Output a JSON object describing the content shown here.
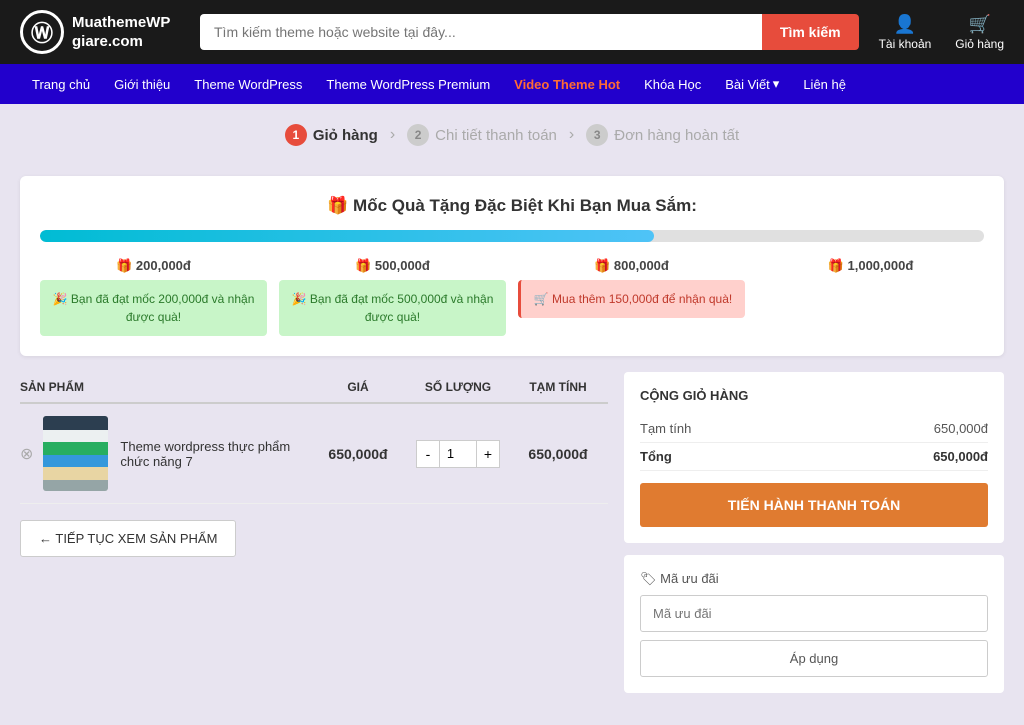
{
  "header": {
    "logo_icon": "Ⓦ",
    "logo_name": "MuathemeWP",
    "logo_subtitle": "giare.com",
    "search_placeholder": "Tìm kiếm theme hoặc website tại đây...",
    "search_btn_label": "Tìm kiếm",
    "account_label": "Tài khoản",
    "cart_label": "Giỏ hàng"
  },
  "nav": {
    "items": [
      {
        "label": "Trang chủ",
        "hot": false,
        "dropdown": false
      },
      {
        "label": "Giới thiệu",
        "hot": false,
        "dropdown": false
      },
      {
        "label": "Theme WordPress",
        "hot": false,
        "dropdown": false
      },
      {
        "label": "Theme WordPress Premium",
        "hot": false,
        "dropdown": false
      },
      {
        "label": "Video Theme Hot",
        "hot": true,
        "dropdown": false
      },
      {
        "label": "Khóa Học",
        "hot": false,
        "dropdown": false
      },
      {
        "label": "Bài Viết",
        "hot": false,
        "dropdown": true
      },
      {
        "label": "Liên hệ",
        "hot": false,
        "dropdown": false
      }
    ]
  },
  "steps": [
    {
      "number": "1",
      "label": "Giỏ hàng",
      "active": true
    },
    {
      "number": "2",
      "label": "Chi tiết thanh toán",
      "active": false
    },
    {
      "number": "3",
      "label": "Đơn hàng hoàn tất",
      "active": false
    }
  ],
  "gift_section": {
    "title": "🎁 Mốc Quà Tặng Đặc Biệt Khi Bạn Mua Sắm:",
    "progress_percent": 65,
    "milestones": [
      {
        "label": "🎁 200,000đ",
        "status": "achieved",
        "message": "🎉 Bạn đã đạt mốc 200,000đ và nhận được quà!"
      },
      {
        "label": "🎁 500,000đ",
        "status": "achieved",
        "message": "🎉 Bạn đã đạt mốc 500,000đ và nhận được quà!"
      },
      {
        "label": "🎁 800,000đ",
        "status": "pending",
        "message": "🛒 Mua thêm 150,000đ để nhận quà!"
      },
      {
        "label": "🎁 1,000,000đ",
        "status": "empty",
        "message": ""
      }
    ]
  },
  "cart": {
    "headers": {
      "product": "SẢN PHẨM",
      "price": "GIÁ",
      "qty": "SỐ LƯỢNG",
      "subtotal": "TẠM TÍNH"
    },
    "items": [
      {
        "name": "Theme wordpress thực phẩm chức năng 7",
        "price": "650,000đ",
        "qty": 1,
        "subtotal": "650,000đ",
        "thumb_colors": [
          "#2c3e50",
          "#ecf0f1",
          "#27ae60",
          "#3498db",
          "#e74c3c",
          "#f1c40f"
        ]
      }
    ],
    "continue_btn": "← TIẾP TỤC XEM SẢN PHẨM"
  },
  "summary": {
    "title": "CỘNG GIỎ HÀNG",
    "rows": [
      {
        "label": "Tạm tính",
        "value": "650,000đ"
      },
      {
        "label": "Tổng",
        "value": "650,000đ"
      }
    ],
    "checkout_btn": "TIẾN HÀNH THANH TOÁN",
    "coupon_label": "🏷 Mã ưu đãi",
    "coupon_placeholder": "Mã ưu đãi",
    "apply_btn": "Áp dụng"
  }
}
